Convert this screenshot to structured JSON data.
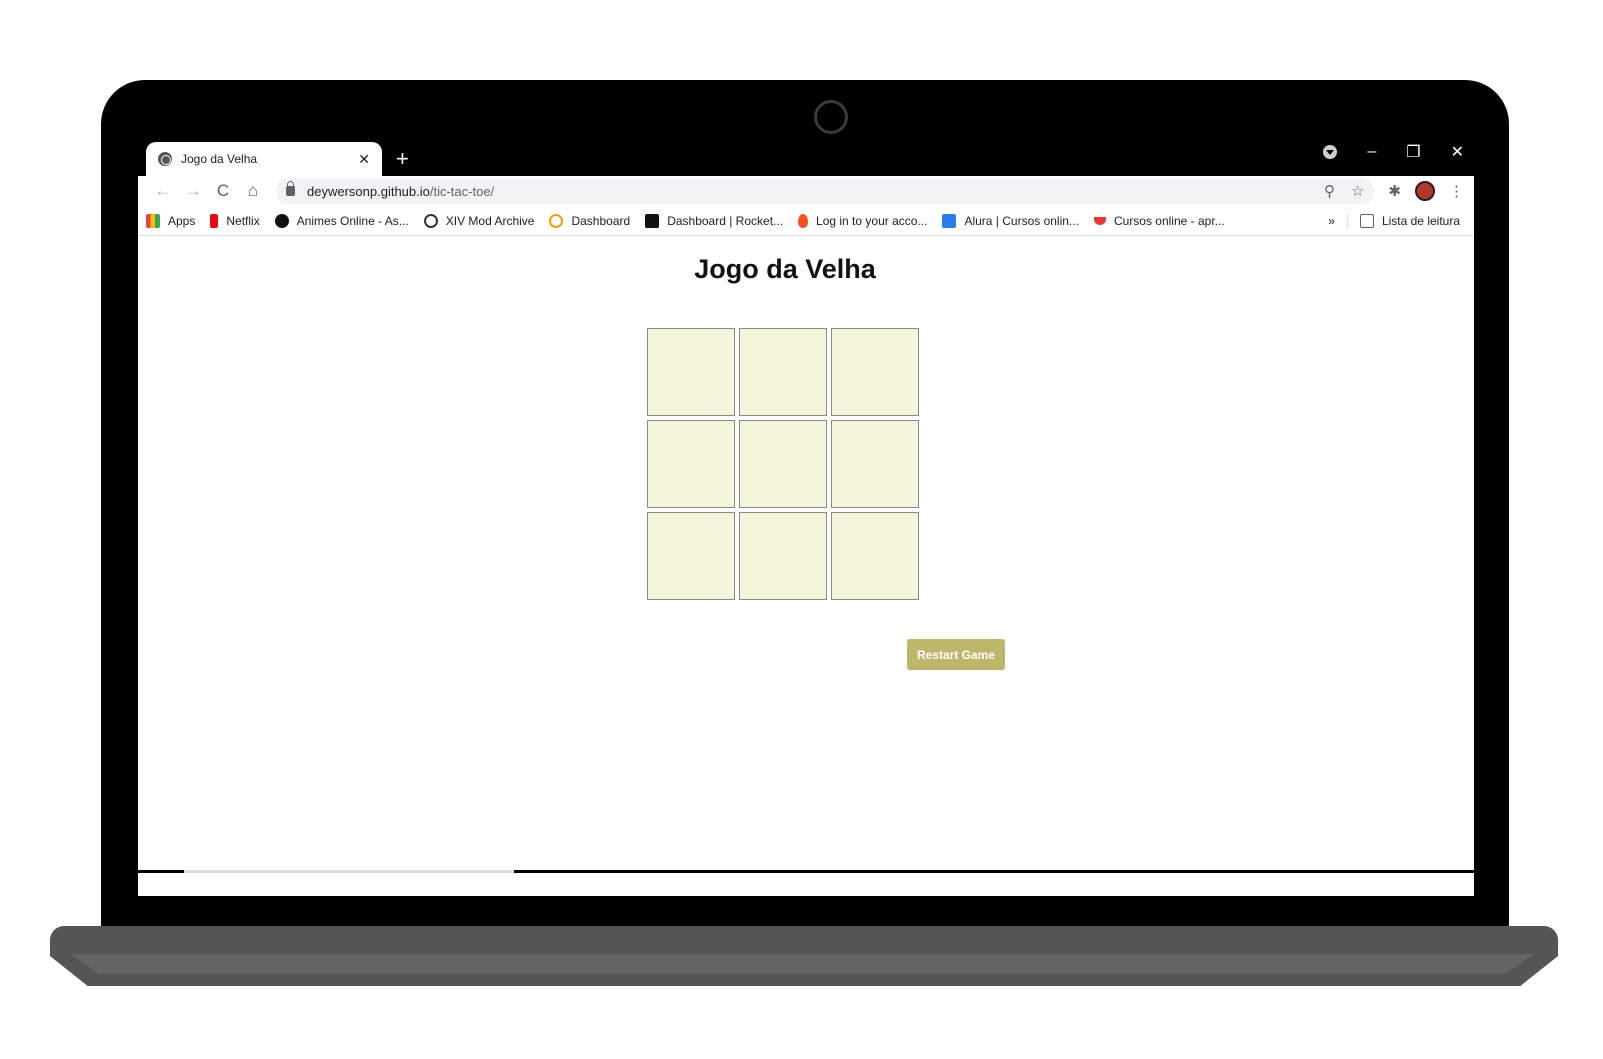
{
  "browser": {
    "tab": {
      "title": "Jogo da Velha",
      "close": "✕"
    },
    "new_tab": "+",
    "window_controls": {
      "minimize": "–",
      "restore": "❐",
      "close": "✕"
    },
    "nav": {
      "back": "←",
      "forward": "→",
      "reload": "C",
      "home": "⌂"
    },
    "address": {
      "host": "deywersonp.github.io",
      "path": "/tic-tac-toe/"
    },
    "omni_icons": {
      "zoom": "⚲",
      "star": "☆"
    },
    "toolbar_icons": {
      "extensions": "✱",
      "menu": "⋮"
    }
  },
  "bookmarks": [
    {
      "label": "Apps",
      "color": "#e0443e"
    },
    {
      "label": "Netflix",
      "color": "#e50914"
    },
    {
      "label": "Animes Online - As...",
      "color": "#111111"
    },
    {
      "label": "XIV Mod Archive",
      "color": "#333333"
    },
    {
      "label": "Dashboard",
      "color": "#f29c11"
    },
    {
      "label": "Dashboard | Rocket...",
      "color": "#111111"
    },
    {
      "label": "Log in to your acco...",
      "color": "#f4511e"
    },
    {
      "label": "Alura | Cursos onlin...",
      "color": "#2b7de9"
    },
    {
      "label": "Cursos online - apr...",
      "color": "#e53935"
    }
  ],
  "bookmarks_more": "»",
  "reading_list": "Lista de leitura",
  "game": {
    "title": "Jogo da Velha",
    "cells": [
      "",
      "",
      "",
      "",
      "",
      "",
      "",
      "",
      ""
    ],
    "restart_label": "Restart Game"
  }
}
